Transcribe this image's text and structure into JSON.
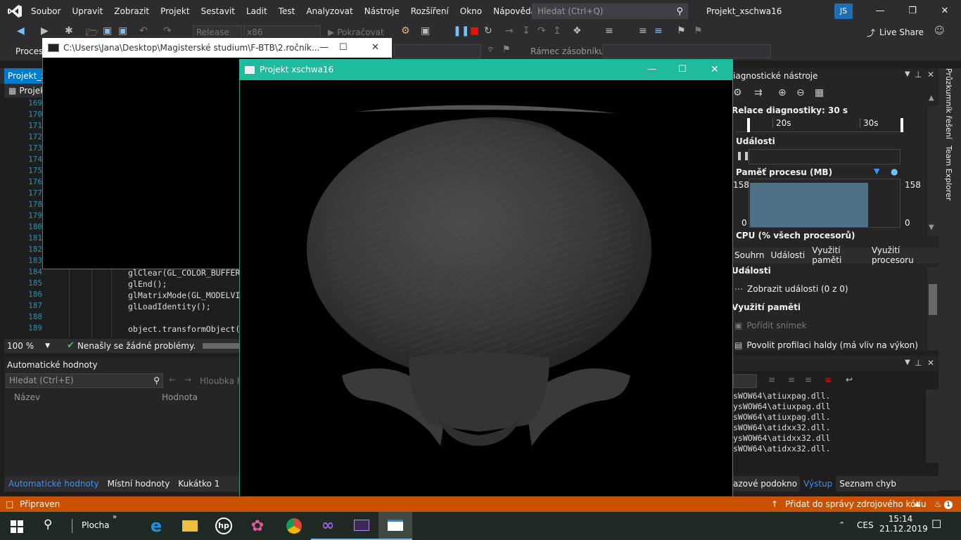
{
  "menubar": {
    "items": [
      "Soubor",
      "Upravit",
      "Zobrazit",
      "Projekt",
      "Sestavit",
      "Ladit",
      "Test",
      "Analyzovat",
      "Nástroje",
      "Rozšíření",
      "Okno",
      "Nápověda"
    ],
    "search_placeholder": "Hledat (Ctrl+Q)",
    "solution_name": "Projekt_xschwa16",
    "user_initials": "JS",
    "accent": "#007acc"
  },
  "toolbar": {
    "config": "Release",
    "platform": "x86",
    "continue_label": "Pokračovat",
    "live_share": "Live Share",
    "process_label": "Proces",
    "frame_label": "Rámec zásobníku:"
  },
  "editor": {
    "tab_label": "Projekt_xs",
    "nav_label": "Projekt",
    "line_numbers": [
      "169",
      "170",
      "171",
      "172",
      "173",
      "174",
      "175",
      "176",
      "177",
      "178",
      "179",
      "180",
      "181",
      "182",
      "183",
      "184",
      "185",
      "186",
      "187",
      "188",
      "189"
    ],
    "code_lines": [
      "glClear(GL_COLOR_BUFFER",
      "glEnd();",
      "glMatrixMode(GL_MODELVI",
      "glLoadIdentity();",
      "",
      "object.transformObject("
    ],
    "zoom": "100 %",
    "status": "Nenašly se žádné problémy."
  },
  "autos": {
    "title": "Automatické hodnoty",
    "search_placeholder": "Hledat (Ctrl+E)",
    "depth_label": "Hloubka h",
    "col_name": "Název",
    "col_value": "Hodnota",
    "tabs": [
      "Automatické hodnoty",
      "Místní hodnoty",
      "Kukátko 1"
    ]
  },
  "console": {
    "title": "C:\\Users\\Jana\\Desktop\\Magisterské studium\\F-BTB\\2.ročník..."
  },
  "glwindow": {
    "title": "Projekt xschwa16",
    "title_color": "#1ebc9c"
  },
  "diagnostics": {
    "title": "iagnostické nástroje",
    "session": "Relace diagnostiky: 30 s",
    "tick_20": "20s",
    "tick_30": "30s",
    "events_label": "Události",
    "memory_label": "Paměť procesu (MB)",
    "mem_max": "158",
    "mem_min": "0",
    "cpu_label": "CPU (% všech procesorů)",
    "tabs": [
      "Souhrn",
      "Události",
      "Využití paměti",
      "Využití procesoru"
    ],
    "section_events": "Události",
    "show_events": "Zobrazit události (0 z 0)",
    "section_memory": "Využití paměti",
    "snapshot": "Pořídit snímek",
    "heap_profiling": "Povolit profilaci haldy (má vliv na výkon)"
  },
  "output": {
    "lines": [
      "sWOW64\\atiuxpag.dll.",
      "ysWOW64\\atiuxpag.dll",
      "sWOW64\\atiuxpag.dll.",
      "sWOW64\\atidxx32.dll.",
      "ysWOW64\\atidxx32.dll",
      "sWOW64\\atidxx32.dll."
    ],
    "tabs": [
      "azové podokno",
      "Výstup",
      "Seznam chyb"
    ]
  },
  "side_tabs": [
    "Průzkumník řešení",
    "Team Explorer"
  ],
  "statusbar": {
    "ready": "Připraven",
    "source_control": "Přidat do správy zdrojového kódu",
    "notifications": "1",
    "color": "#ca5100"
  },
  "taskbar": {
    "desktop_label": "Plocha",
    "language": "CES",
    "time": "15:14",
    "date": "21.12.2019"
  }
}
